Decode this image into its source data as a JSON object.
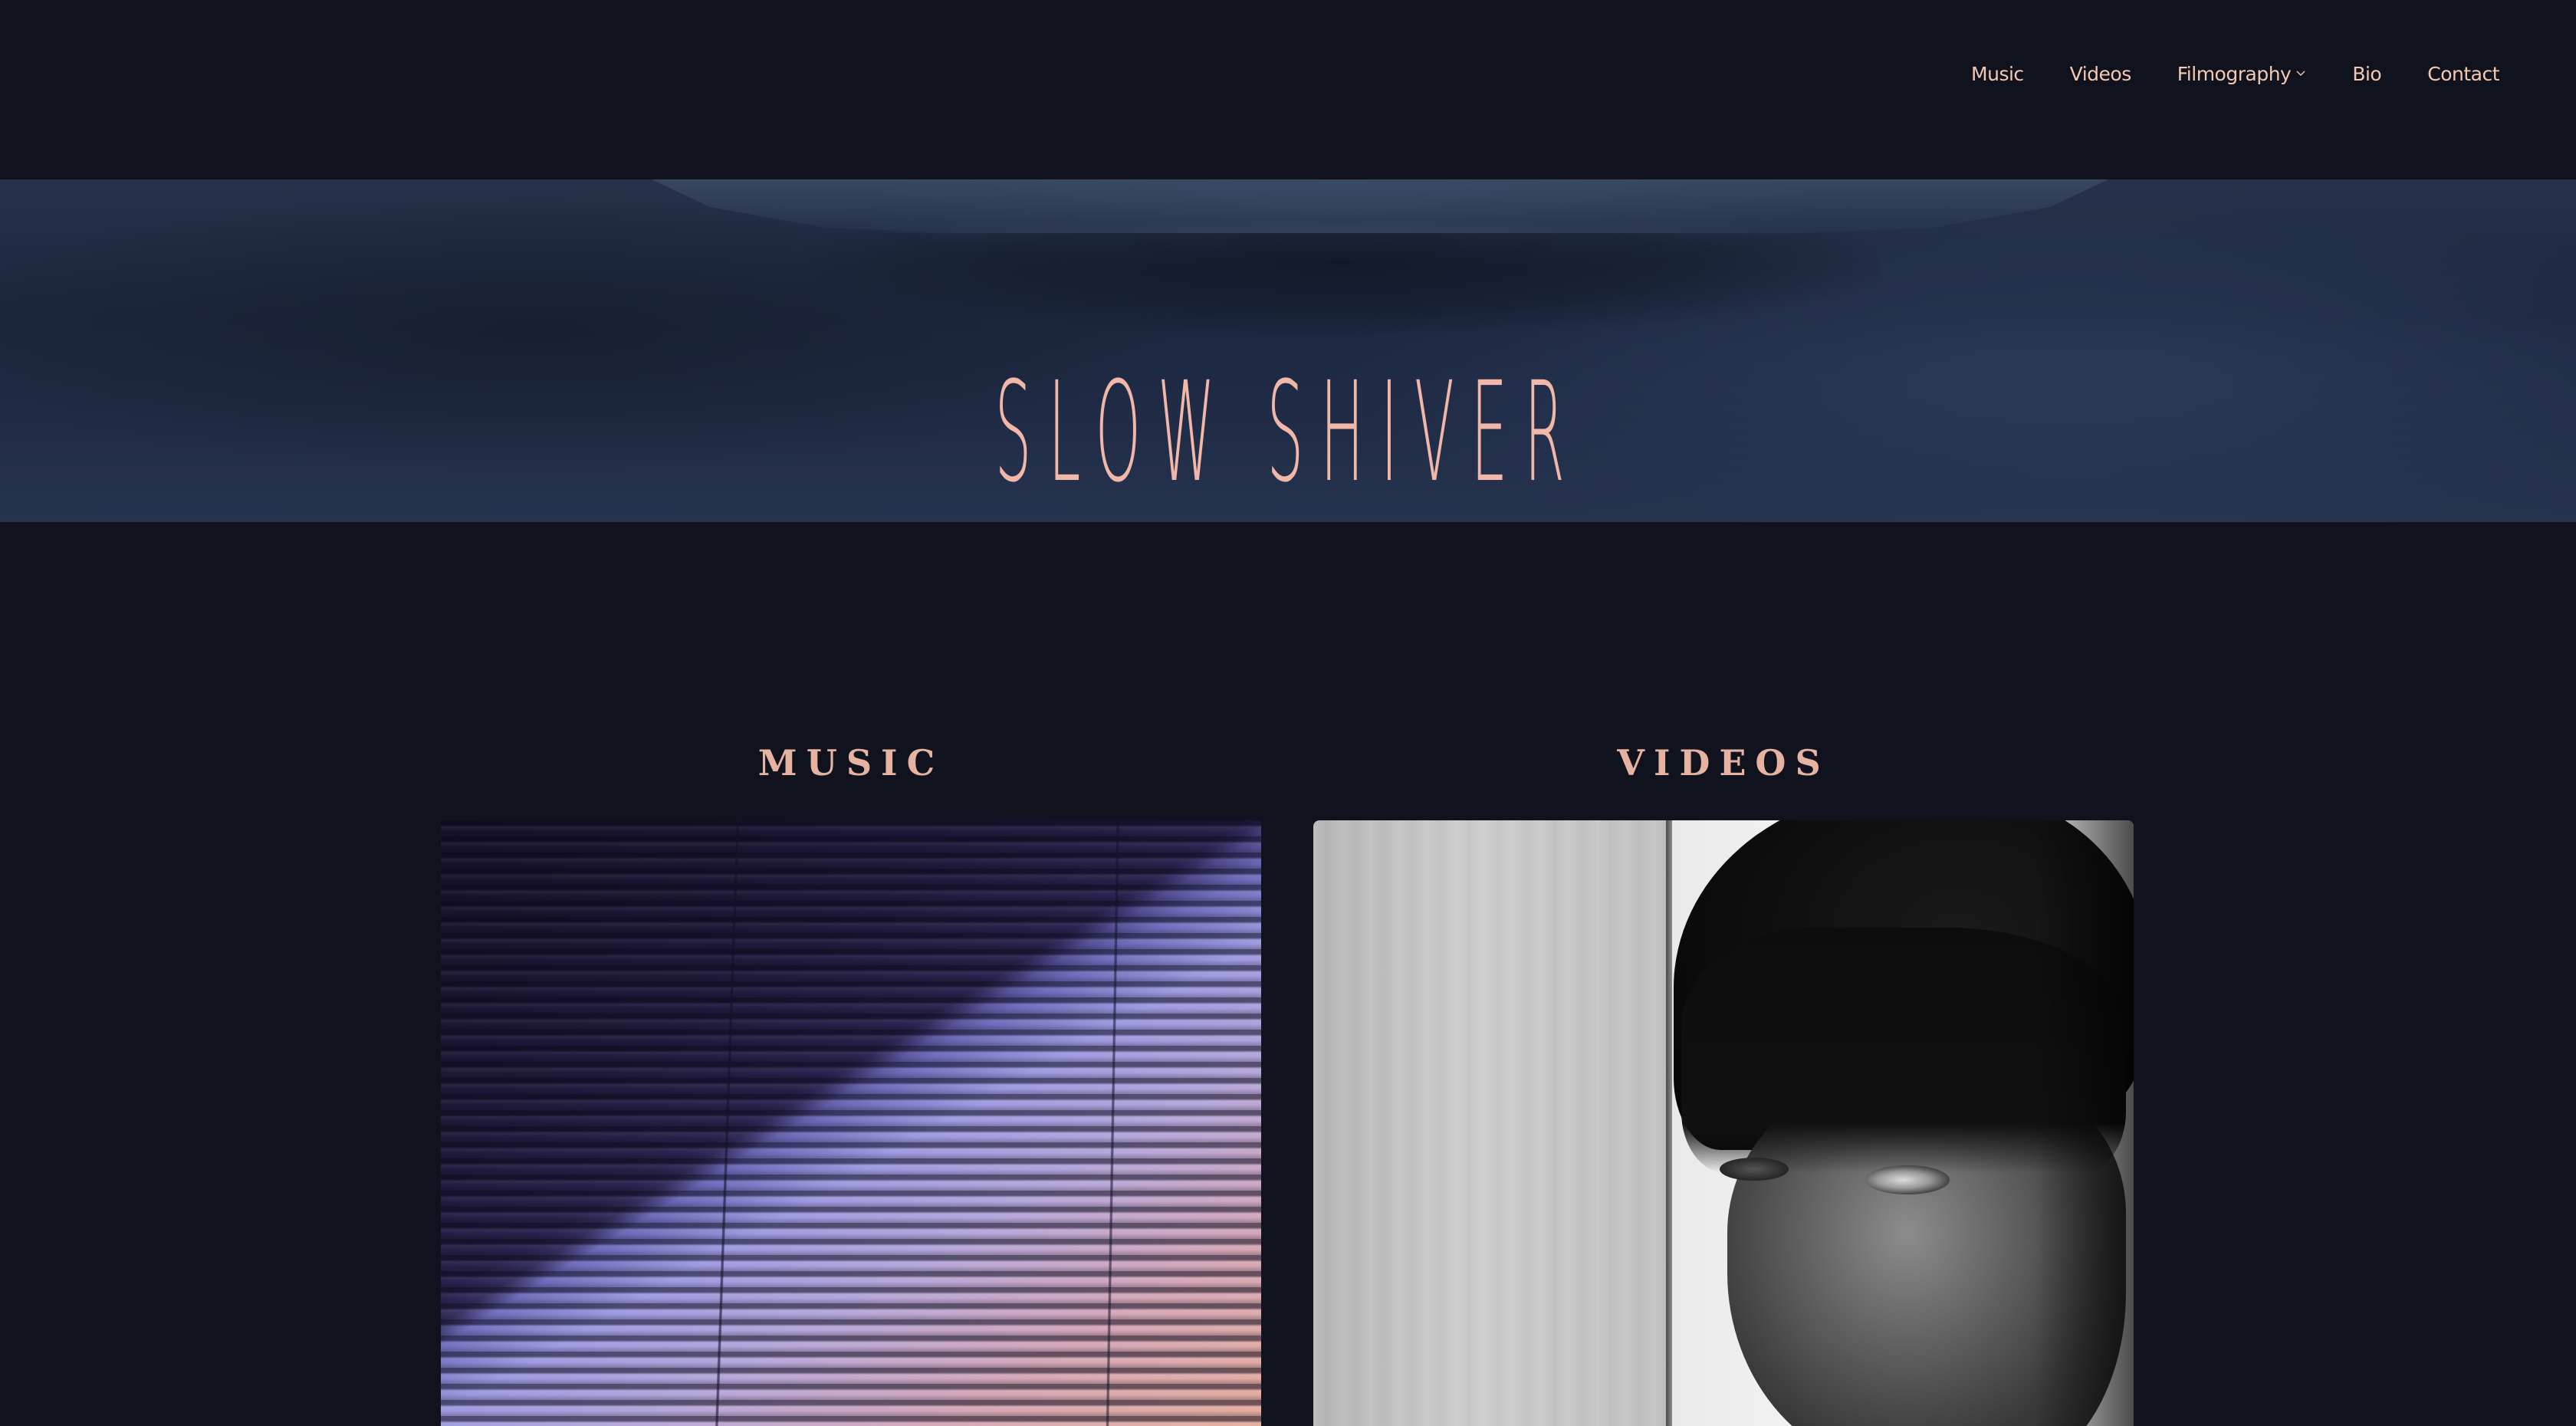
{
  "nav": {
    "items": [
      {
        "label": "Music"
      },
      {
        "label": "Videos"
      },
      {
        "label": "Filmography",
        "has_dropdown": true
      },
      {
        "label": "Bio"
      },
      {
        "label": "Contact"
      }
    ]
  },
  "hero": {
    "title": "SLOW SHIVER"
  },
  "sections": {
    "music": {
      "heading": "MUSIC"
    },
    "videos": {
      "heading": "VIDEOS"
    }
  },
  "colors": {
    "background": "#10131d",
    "accent": "#f1b7a8",
    "nav_text": "#f3c9b4"
  }
}
